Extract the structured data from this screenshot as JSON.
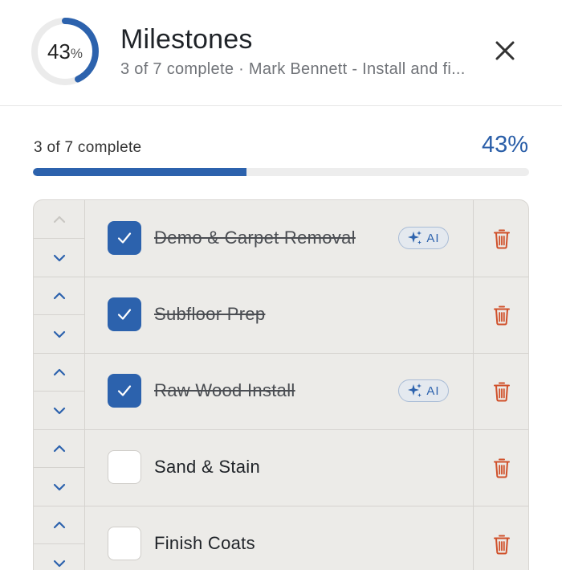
{
  "header": {
    "progress_ring": {
      "number": "43",
      "unit": "%",
      "fraction": 0.43
    },
    "title": "Milestones",
    "subtitle": "3 of 7 complete · Mark Bennett - Install and fi...",
    "close_icon": "close-icon"
  },
  "progress": {
    "label": "3 of 7 complete",
    "percent_text": "43%",
    "fraction": 0.43,
    "fill_color": "#2c62ad",
    "track_color": "#ededed"
  },
  "colors": {
    "accent": "#2c62ad",
    "delete": "#d0502a",
    "ai_badge_bg": "#e4e9ef"
  },
  "milestones": [
    {
      "title": "Demo & Carpet Removal",
      "completed": true,
      "ai": true,
      "ai_label": "AI",
      "up_disabled": true
    },
    {
      "title": "Subfloor Prep",
      "completed": true,
      "ai": false,
      "up_disabled": false
    },
    {
      "title": "Raw Wood Install",
      "completed": true,
      "ai": true,
      "ai_label": "AI",
      "up_disabled": false
    },
    {
      "title": "Sand & Stain",
      "completed": false,
      "ai": false,
      "up_disabled": false
    },
    {
      "title": "Finish Coats",
      "completed": false,
      "ai": false,
      "up_disabled": false
    }
  ]
}
